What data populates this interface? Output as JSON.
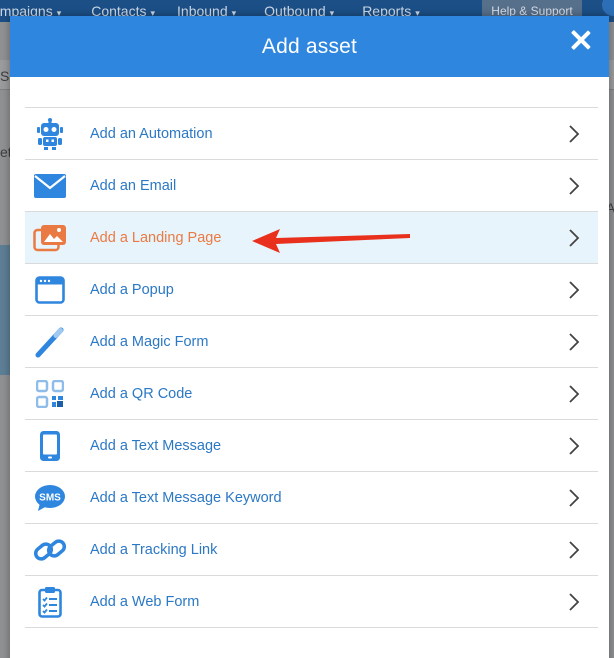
{
  "background": {
    "nav": [
      {
        "label": "ampaigns",
        "caret": "▾"
      },
      {
        "label": "Contacts",
        "caret": "▾"
      },
      {
        "label": "Inbound",
        "caret": "▾"
      },
      {
        "label": "Outbound",
        "caret": "▾"
      },
      {
        "label": "Reports",
        "caret": "▾"
      }
    ],
    "help_label": "Help & Support",
    "side_text_1": "S",
    "side_text_2": "et",
    "right_text_1": "A"
  },
  "modal": {
    "title": "Add asset",
    "items": [
      {
        "label": "Add an Automation",
        "icon": "robot-icon"
      },
      {
        "label": "Add an Email",
        "icon": "envelope-icon"
      },
      {
        "label": "Add a Landing Page",
        "icon": "landing-page-icon",
        "highlighted": true
      },
      {
        "label": "Add a Popup",
        "icon": "popup-window-icon"
      },
      {
        "label": "Add a Magic Form",
        "icon": "magic-wand-icon"
      },
      {
        "label": "Add a QR Code",
        "icon": "qr-code-icon"
      },
      {
        "label": "Add a Text Message",
        "icon": "mobile-phone-icon"
      },
      {
        "label": "Add a Text Message Keyword",
        "icon": "sms-bubble-icon"
      },
      {
        "label": "Add a Tracking Link",
        "icon": "link-icon"
      },
      {
        "label": "Add a Web Form",
        "icon": "clipboard-icon"
      }
    ]
  },
  "colors": {
    "header_blue": "#2f86de",
    "link_blue": "#2b78c4",
    "highlight_orange": "#ea7a44",
    "highlight_bg": "#e8f4fb",
    "annotation_red": "#e8301c"
  }
}
